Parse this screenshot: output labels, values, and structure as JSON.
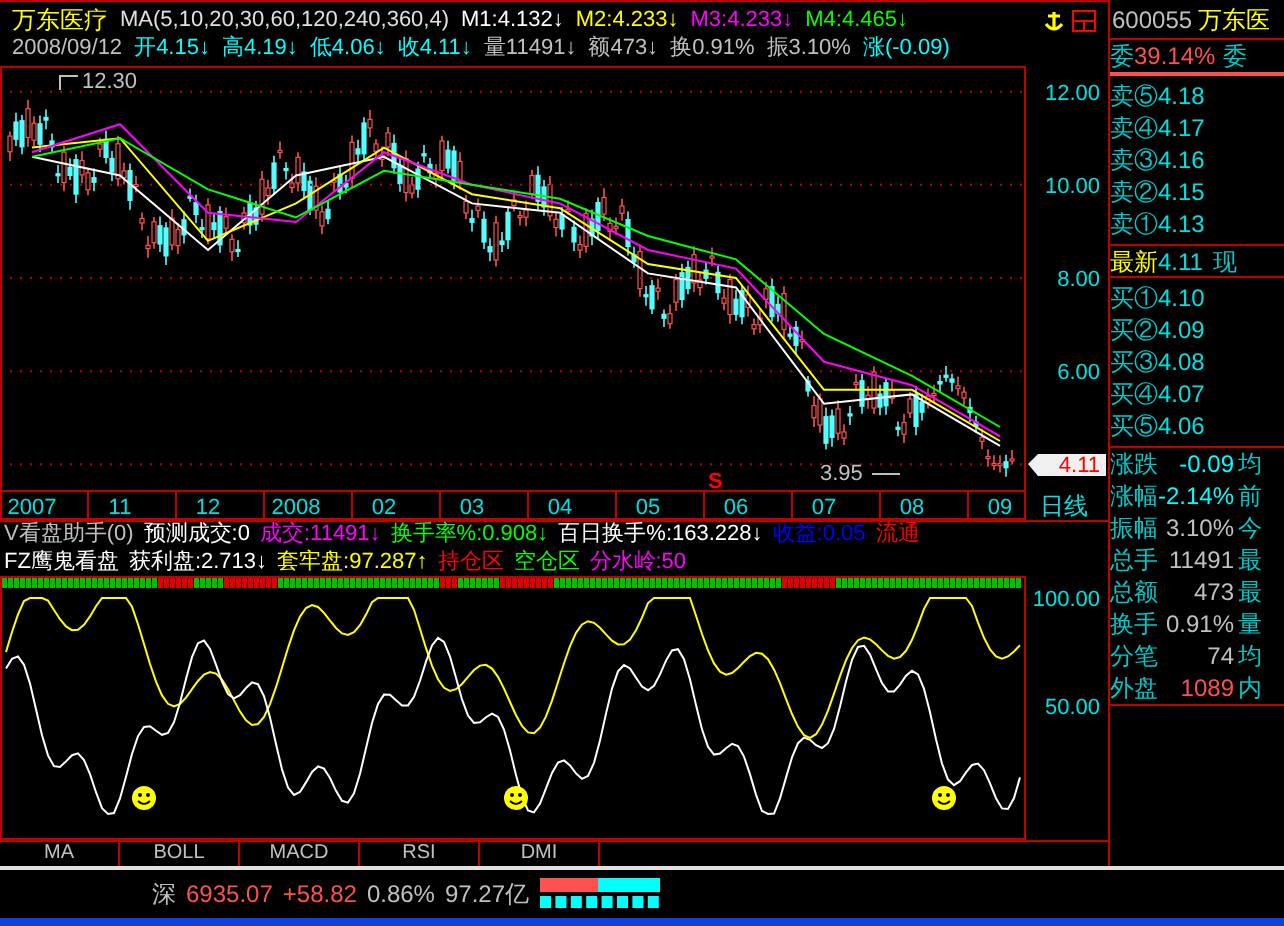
{
  "header": {
    "stock_name": "万东医疗",
    "indicator": "MA(5,10,20,30,60,120,240,360,4)",
    "ma_values": [
      {
        "text": "M1:4.132↓",
        "color": "#ffffff"
      },
      {
        "text": "M2:4.233↓",
        "color": "#ffff00"
      },
      {
        "text": "M3:4.233↓",
        "color": "#ff00ff"
      },
      {
        "text": "M4:4.465↓",
        "color": "#00ff00"
      }
    ]
  },
  "quote_line": {
    "date": "2008/09/12",
    "items": [
      {
        "text": "开4.15↓",
        "color": "#00ffff"
      },
      {
        "text": "高4.19↓",
        "color": "#00ffff"
      },
      {
        "text": "低4.06↓",
        "color": "#00ffff"
      },
      {
        "text": "收4.11↓",
        "color": "#00ffff"
      },
      {
        "text": "量11491↓",
        "color": "#c0c0c0"
      },
      {
        "text": "额473↓",
        "color": "#c0c0c0"
      },
      {
        "text": "换0.91%",
        "color": "#c0c0c0"
      },
      {
        "text": "振3.10%",
        "color": "#c0c0c0"
      },
      {
        "text": "涨(-0.09)",
        "color": "#00ffff"
      }
    ]
  },
  "main_chart": {
    "high_label": "12.30",
    "low_label": "3.95",
    "signal": "S",
    "last_price": "4.11",
    "period": "日线",
    "chart_data": {
      "type": "line",
      "grid": true,
      "categories": [
        "2007",
        "11",
        "12",
        "2008",
        "02",
        "03",
        "04",
        "05",
        "06",
        "07",
        "08",
        "09"
      ],
      "ylim": [
        3.45,
        12.55
      ],
      "yticks": [
        {
          "value": 12,
          "label": "12.00"
        },
        {
          "value": 10,
          "label": "10.00"
        },
        {
          "value": 8,
          "label": "8.00"
        },
        {
          "value": 6,
          "label": "6.00"
        }
      ],
      "series": [
        {
          "color": "#ffffff",
          "values": [
            10.6,
            10.2,
            8.6,
            10.2,
            10.6,
            9.6,
            9.4,
            8.1,
            7.8,
            5.3,
            5.5,
            4.4
          ]
        },
        {
          "color": "#ffff00",
          "values": [
            10.8,
            11.0,
            8.8,
            9.6,
            10.8,
            9.8,
            9.5,
            8.3,
            8.0,
            5.6,
            5.6,
            4.5
          ]
        },
        {
          "color": "#ff00ff",
          "values": [
            10.7,
            11.3,
            9.4,
            9.2,
            10.7,
            10.0,
            9.6,
            8.6,
            8.2,
            6.2,
            5.7,
            4.6
          ]
        },
        {
          "color": "#00ff00",
          "values": [
            10.6,
            11.0,
            9.9,
            9.3,
            10.3,
            10.0,
            9.7,
            8.9,
            8.4,
            6.8,
            5.9,
            4.8
          ]
        }
      ]
    }
  },
  "indicator_lines": [
    {
      "segments": [
        {
          "text": "V看盘助手(0)",
          "color": "#c0c0c0"
        },
        {
          "text": "预测成交:0",
          "color": "#ffffff"
        },
        {
          "text": "成交:11491↓",
          "color": "#ff00ff"
        },
        {
          "text": "换手率%:0.908↓",
          "color": "#00ff00"
        },
        {
          "text": "百日换手%:163.228↓",
          "color": "#ffffff"
        },
        {
          "text": "收益:0.05",
          "color": "#0000ff"
        },
        {
          "text": "流通",
          "color": "#ff0000"
        }
      ]
    },
    {
      "segments": [
        {
          "text": "FZ鹰鬼看盘",
          "color": "#ffffff"
        },
        {
          "text": "获利盘:2.713↓",
          "color": "#ffffff"
        },
        {
          "text": "套牢盘:97.287↑",
          "color": "#ffff00"
        },
        {
          "text": "持仓区",
          "color": "#ff0000"
        },
        {
          "text": "空仓区",
          "color": "#00ff00"
        },
        {
          "text": "分水岭:50",
          "color": "#ff00ff"
        }
      ]
    }
  ],
  "indicator_chart": {
    "ticks": [
      "100.00",
      "50.00"
    ]
  },
  "indicator_tabs": [
    "MA",
    "BOLL",
    "MACD",
    "RSI",
    "DMI"
  ],
  "quote_panel": {
    "code": "600055",
    "name": "万东医",
    "ratio_label": "委",
    "ratio_value": "39.14%",
    "ratio_label_2": "委",
    "sells": [
      {
        "label": "卖⑤",
        "price": "4.18"
      },
      {
        "label": "卖④",
        "price": "4.17"
      },
      {
        "label": "卖③",
        "price": "4.16"
      },
      {
        "label": "卖②",
        "price": "4.15"
      },
      {
        "label": "卖①",
        "price": "4.13"
      }
    ],
    "latest": {
      "label": "最新",
      "price": "4.11",
      "label_2": "现"
    },
    "buys": [
      {
        "label": "买①",
        "price": "4.10"
      },
      {
        "label": "买②",
        "price": "4.09"
      },
      {
        "label": "买③",
        "price": "4.08"
      },
      {
        "label": "买④",
        "price": "4.07"
      },
      {
        "label": "买⑤",
        "price": "4.06"
      }
    ],
    "stats": [
      {
        "label": "涨跌",
        "value": "-0.09",
        "label_2": "均",
        "color": "#00ffff"
      },
      {
        "label": "涨幅",
        "value": "-2.14%",
        "label_2": "前",
        "color": "#00ffff"
      },
      {
        "label": "振幅",
        "value": "3.10%",
        "label_2": "今",
        "color": "#c0c0c0"
      },
      {
        "label": "总手",
        "value": "11491",
        "label_2": "最",
        "color": "#c0c0c0"
      },
      {
        "label": "总额",
        "value": "473",
        "label_2": "最",
        "color": "#c0c0c0"
      },
      {
        "label": "换手",
        "value": "0.91%",
        "label_2": "量",
        "color": "#c0c0c0"
      },
      {
        "label": "分笔",
        "value": "74",
        "label_2": "均",
        "color": "#c0c0c0"
      },
      {
        "label": "外盘",
        "value": "1089",
        "label_2": "内",
        "color": "#ff5050"
      }
    ]
  },
  "status_bar": {
    "market": "深",
    "index": "6935.07",
    "change": "+58.82",
    "percent": "0.86%",
    "amount": "97.27亿",
    "level": 0.49
  }
}
